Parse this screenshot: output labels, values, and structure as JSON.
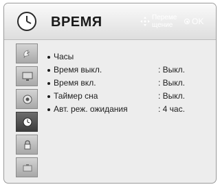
{
  "header": {
    "title": "ВРЕМЯ",
    "hint_move": "Переме щение",
    "hint_ok": "OK",
    "icon": "clock-icon"
  },
  "sidebar": {
    "items": [
      {
        "icon": "satellite-dish-icon",
        "active": false
      },
      {
        "icon": "monitor-icon",
        "active": false
      },
      {
        "icon": "audio-icon",
        "active": false
      },
      {
        "icon": "clock-icon",
        "active": true
      },
      {
        "icon": "lock-icon",
        "active": false
      },
      {
        "icon": "options-icon",
        "active": false
      }
    ]
  },
  "menu": {
    "items": [
      {
        "label": "Часы",
        "value": ""
      },
      {
        "label": "Время выкл.",
        "value": ": Выкл."
      },
      {
        "label": "Время вкл.",
        "value": ": Выкл."
      },
      {
        "label": "Таймер сна",
        "value": ": Выкл."
      },
      {
        "label": "Авт. реж. ожидания",
        "value": ": 4 час."
      }
    ]
  },
  "colors": {
    "active_item": "#4a4a4a",
    "panel_bg": "#ededed",
    "hint_text": "#ffffff"
  }
}
